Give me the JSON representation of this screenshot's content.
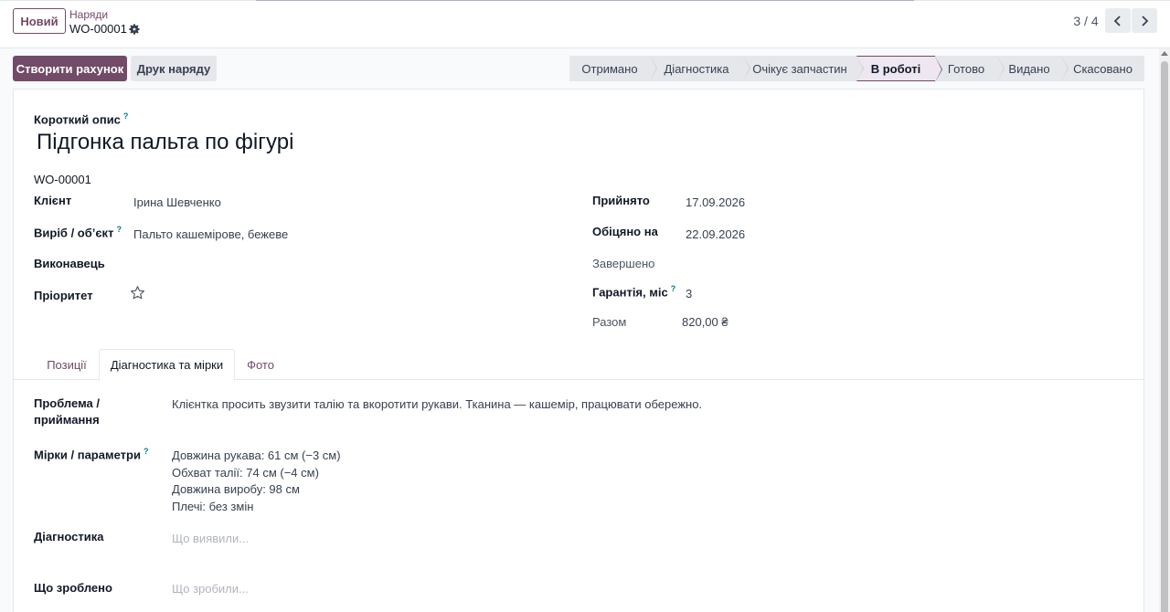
{
  "control": {
    "new_label": "Новий",
    "breadcrumb_parent": "Наряди",
    "breadcrumb_current": "WO-00001",
    "pager": "3 / 4"
  },
  "actions": {
    "create_invoice": "Створити рахунок",
    "print_order": "Друк наряду"
  },
  "statusbar": {
    "stages": [
      "Отримано",
      "Діагностика",
      "Очікує запчастин",
      "В роботі",
      "Готово",
      "Видано",
      "Скасовано"
    ],
    "active": "В роботі"
  },
  "form": {
    "short_desc_label": "Короткий опис",
    "title": "Підгонка пальта по фігурі",
    "reference": "WO-00001",
    "client_label": "Клієнт",
    "client_value": "Ірина Шевченко",
    "item_label": "Виріб / об’єкт",
    "item_value": "Пальто кашемірове, бежеве",
    "executor_label": "Виконавець",
    "priority_label": "Пріоритет",
    "accepted_label": "Прийнято",
    "accepted_value": "17.09.2026",
    "promised_label": "Обіцяно на",
    "promised_value": "22.09.2026",
    "completed_label": "Завершено",
    "warranty_label": "Гарантія, міс",
    "warranty_value": "3",
    "total_label": "Разом",
    "total_value": "820,00 ₴",
    "help_mark": "?"
  },
  "tabs": [
    "Позиції",
    "Діагностика та мірки",
    "Фото"
  ],
  "diagnostics": {
    "problem_label_1": "Проблема /",
    "problem_label_2": "приймання",
    "problem_value": "Клієнтка просить звузити талію та вкоротити рукави. Тканина — кашемір, працювати обережно.",
    "measures_label": "Мірки / параметри",
    "measures": [
      "Довжина рукава: 61 см (−3 см)",
      "Обхват талії: 74 см (−4 см)",
      "Довжина виробу: 98 см",
      "Плечі: без змін"
    ],
    "diag_label": "Діагностика",
    "diag_placeholder": "Що виявили...",
    "done_label": "Що зроблено",
    "done_placeholder": "Що зробили..."
  }
}
